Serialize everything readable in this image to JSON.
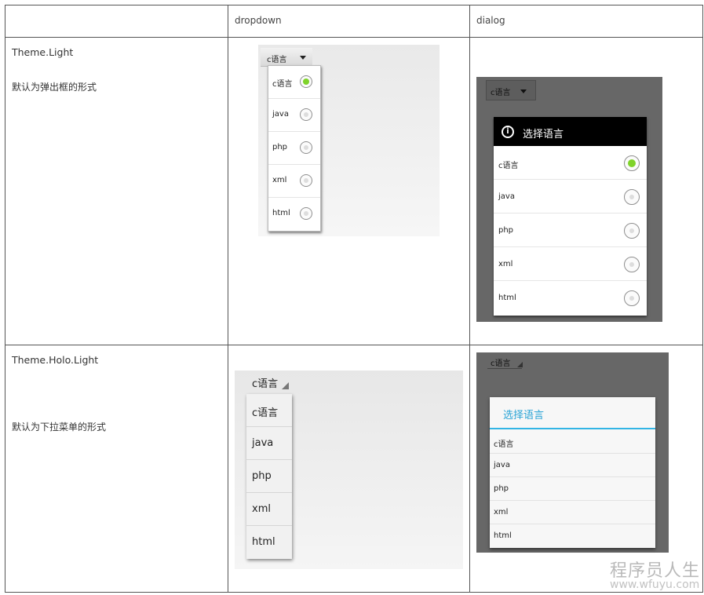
{
  "headers": {
    "col1": "",
    "col2": "dropdown",
    "col3": "dialog"
  },
  "rows": [
    {
      "theme": "Theme.Light",
      "description": "默认为弹出框的形式",
      "dropdown": {
        "spinner_value": "c语言",
        "items": [
          "c语言",
          "java",
          "php",
          "xml",
          "html"
        ],
        "selected_index": 0
      },
      "dialog": {
        "spinner_value": "c语言",
        "title": "选择语言",
        "items": [
          "c语言",
          "java",
          "php",
          "xml",
          "html"
        ],
        "selected_index": 0
      }
    },
    {
      "theme": "Theme.Holo.Light",
      "description": "默认为下拉菜单的形式",
      "dropdown": {
        "spinner_value": "c语言",
        "items": [
          "c语言",
          "java",
          "php",
          "xml",
          "html"
        ]
      },
      "dialog": {
        "spinner_value": "c语言",
        "title": "选择语言",
        "items": [
          "c语言",
          "java",
          "php",
          "xml",
          "html"
        ]
      }
    }
  ],
  "watermark": {
    "name": "程序员人生",
    "url": "www.wfuyu.com"
  },
  "colors": {
    "holo_accent": "#33b5e5",
    "radio_checked": "#7fd32a",
    "dialog_backdrop": "#676767"
  }
}
